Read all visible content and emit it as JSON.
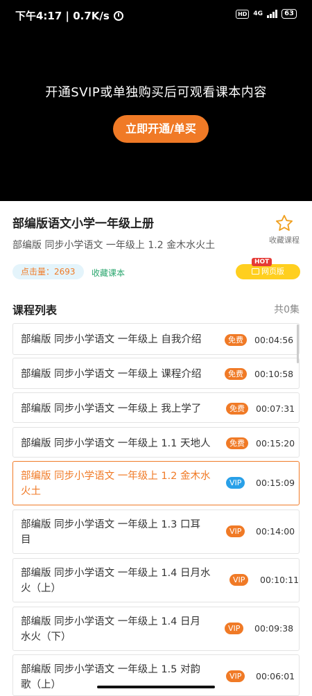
{
  "status_bar": {
    "time_speed": "下午4:17 | 0.7K/s",
    "hd": "HD",
    "network": "4G",
    "battery": "63",
    "icons": [
      "alarm-icon",
      "hd-icon",
      "signal-icon",
      "battery-icon"
    ]
  },
  "video": {
    "message": "开通SVIP或单独购买后可观看课本内容",
    "button_label": "立即开通/单买"
  },
  "course": {
    "title": "部编版语文小学一年级上册",
    "subtitle": "部编版 同步小学语文 一年级上 1.2 金木水火土",
    "favorite_label": "收藏课程",
    "click_label": "点击量：2693",
    "collect_link": "收藏课本",
    "hot": "HOT",
    "web_label": "网页版"
  },
  "list": {
    "header": "课程列表",
    "count": "共0集",
    "lessons": [
      {
        "title1": "部编版 同步小学语文 一年级上 自我介绍",
        "title2": "",
        "badge": "免费",
        "duration": "00:04:56",
        "active": false
      },
      {
        "title1": "部编版 同步小学语文 一年级上 课程介绍",
        "title2": "",
        "badge": "免费",
        "duration": "00:10:58",
        "active": false
      },
      {
        "title1": "部编版 同步小学语文 一年级上 我上学了",
        "title2": "",
        "badge": "免费",
        "duration": "00:07:31",
        "active": false
      },
      {
        "title1": "部编版 同步小学语文 一年级上 1.1 天地人",
        "title2": "",
        "badge": "免费",
        "duration": "00:15:20",
        "active": false
      },
      {
        "title1": "部编版 同步小学语文 一年级上 1.2 金木水",
        "title2": "火土",
        "badge": "VIP",
        "duration": "00:15:09",
        "active": true
      },
      {
        "title1": "部编版 同步小学语文 一年级上 1.3 口耳",
        "title2": "目",
        "badge": "VIP",
        "duration": "00:14:00",
        "active": false
      },
      {
        "title1": "部编版 同步小学语文 一年级上 1.4 日月水",
        "title2": "火（上）",
        "badge": "VIP",
        "duration": "00:10:11",
        "active": false
      },
      {
        "title1": "部编版 同步小学语文 一年级上 1.4 日月",
        "title2": "水火（下）",
        "badge": "VIP",
        "duration": "00:09:38",
        "active": false
      },
      {
        "title1": "部编版 同步小学语文 一年级上 1.5 对韵",
        "title2": "歌（上）",
        "badge": "VIP",
        "duration": "00:06:01",
        "active": false
      }
    ]
  },
  "colors": {
    "accent": "#f07a26",
    "vip_active": "#29a0e8",
    "web_button": "#ffcf1f",
    "hot": "#e53935"
  }
}
